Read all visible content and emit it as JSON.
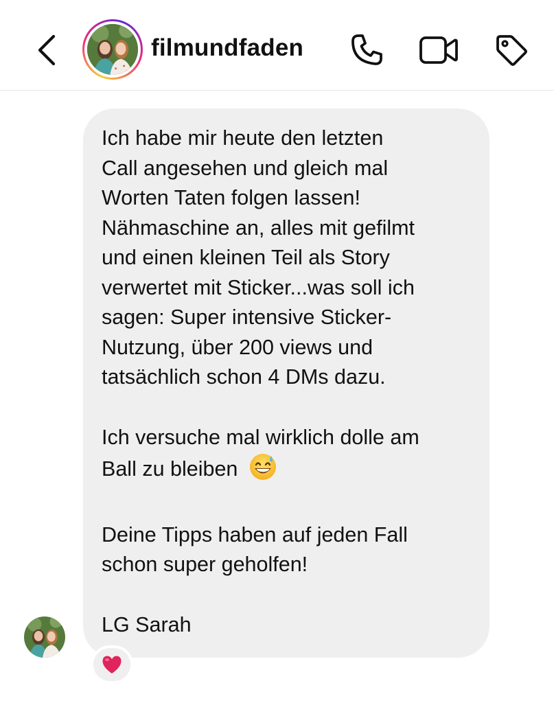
{
  "header": {
    "username": "filmundfaden",
    "icons": {
      "back": "chevron-left-icon",
      "phone": "phone-icon",
      "video": "video-camera-icon",
      "tag": "tag-icon"
    },
    "story_ring_colors": [
      "#f9ce34",
      "#ee2a7b",
      "#6228d7"
    ]
  },
  "message": {
    "paragraph_1": "Ich habe mir heute den letzten\nCall angesehen und gleich mal\nWorten Taten folgen lassen!\nNähmaschine an, alles mit gefilmt\nund einen kleinen Teil als Story\nverwertet mit Sticker...was soll ich\nsagen: Super intensive Sticker-\nNutzung, über 200 views und\ntatsächlich schon 4 DMs dazu.",
    "paragraph_2": "Ich versuche mal wirklich dolle am\nBall zu bleiben",
    "paragraph_2_emoji": "grinning-face-with-sweat-emoji",
    "paragraph_3": "Deine Tipps haben auf jeden Fall\nschon super geholfen!",
    "signature": "LG Sarah",
    "bubble_color": "#efefef"
  },
  "reaction": {
    "emoji": "red-heart-emoji",
    "color": "#e0245e"
  }
}
